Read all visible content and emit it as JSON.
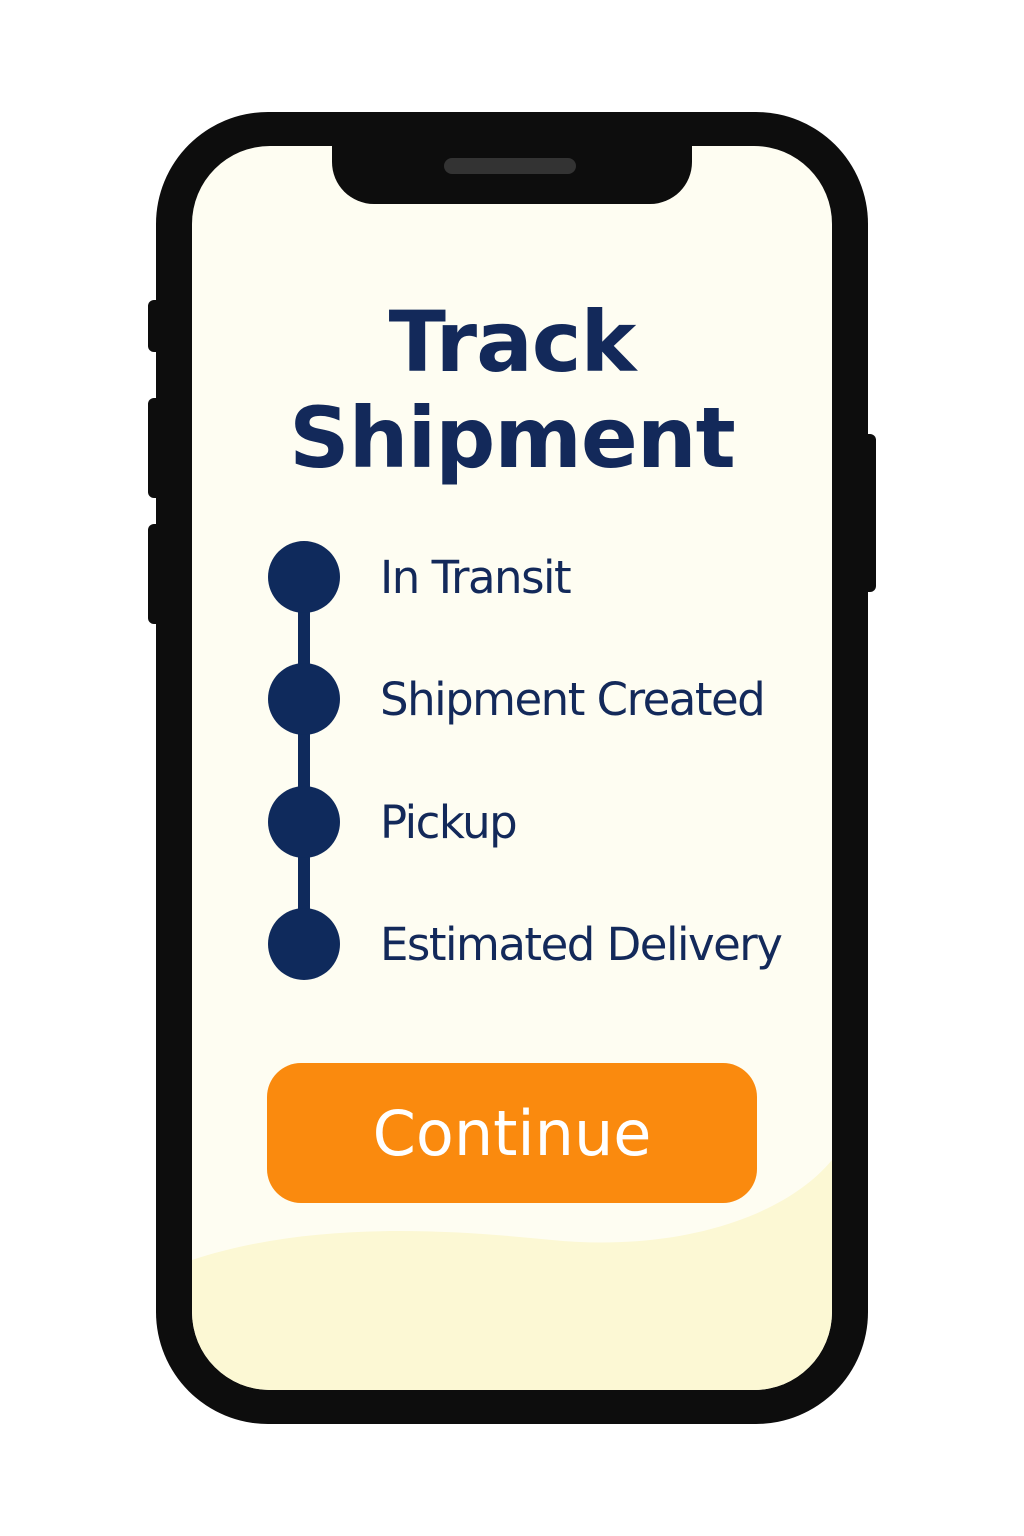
{
  "screen": {
    "title_line1": "Track",
    "title_line2": "Shipment",
    "steps": [
      {
        "label": "In Transit"
      },
      {
        "label": "Shipment Created"
      },
      {
        "label": "Pickup"
      },
      {
        "label": "Estimated Delivery"
      }
    ],
    "continue_label": "Continue"
  },
  "colors": {
    "primary_navy": "#0f2a5c",
    "accent_orange": "#fa8a0e",
    "screen_background": "#fefdf2",
    "phone_frame": "#0d0d0d"
  }
}
